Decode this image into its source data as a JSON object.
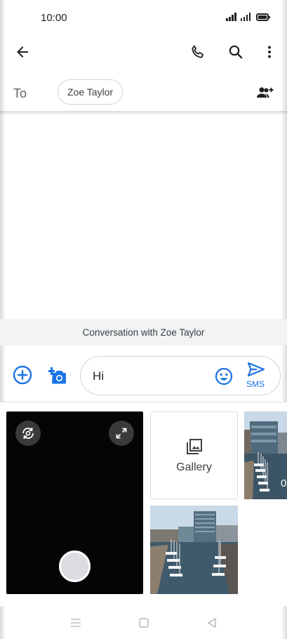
{
  "status_bar": {
    "time": "10:00"
  },
  "app_bar": {
    "back_icon": "arrow-back-icon",
    "call_icon": "phone-icon",
    "search_icon": "search-icon",
    "more_icon": "more-vert-icon"
  },
  "recipients": {
    "to_label": "To",
    "chip_name": "Zoe Taylor",
    "add_people_icon": "group-add-icon"
  },
  "conversation": {
    "banner": "Conversation with Zoe Taylor"
  },
  "compose": {
    "add_icon": "add-circle-icon",
    "media_icon": "add-photo-icon",
    "message_value": "Hi",
    "emoji_icon": "emoji-icon",
    "send_icon": "send-icon",
    "send_label": "SMS"
  },
  "media": {
    "gallery_label": "Gallery",
    "partial_overlay_text": "0"
  },
  "nav_bar": {
    "menu_icon": "menu-icon",
    "home_icon": "home-square-icon",
    "back_icon": "back-triangle-icon"
  },
  "colors": {
    "accent": "#1a73e8",
    "chip_border": "#cfd2d6",
    "banner_bg": "#f1f3f4"
  }
}
